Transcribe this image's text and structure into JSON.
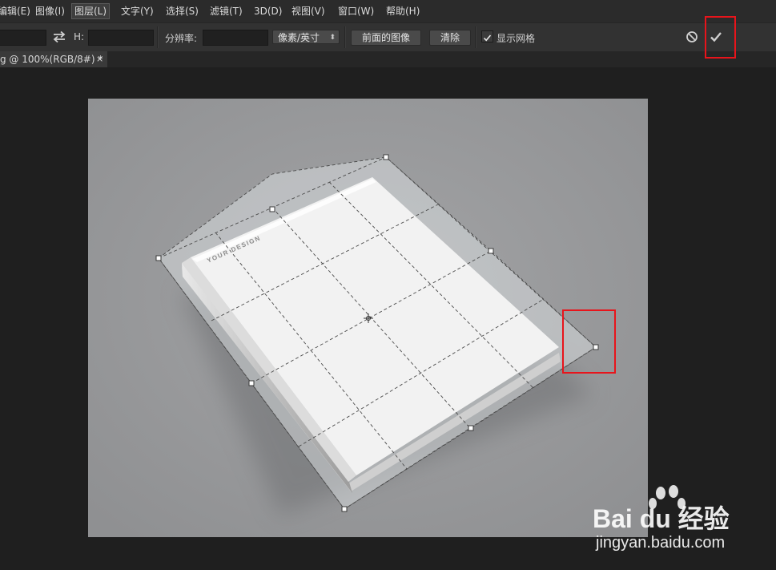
{
  "menubar": {
    "items": [
      "编辑(E)",
      "图像(I)",
      "图层(L)",
      "文字(Y)",
      "选择(S)",
      "滤镜(T)",
      "3D(D)",
      "视图(V)",
      "窗口(W)",
      "帮助(H)"
    ]
  },
  "options": {
    "height_label": "H:",
    "resolution_label": "分辨率:",
    "unit_select": "像素/英寸",
    "front_image_button": "前面的图像",
    "clear_button": "清除",
    "show_grid_label": "显示网格",
    "show_grid_checked": true,
    "swap_icon": "swap-arrows-icon",
    "cancel_icon": "cancel-icon",
    "commit_icon": "checkmark-icon"
  },
  "tab": {
    "title": "g @ 100%(RGB/8#) *",
    "close": "×"
  },
  "artwork": {
    "cover_text": "YOUR DESIGN"
  },
  "watermark": {
    "brand": "Bai du 经验",
    "url": "jingyan.baidu.com"
  },
  "colors": {
    "highlight": "#e8141b",
    "canvas_bg": "#98999b"
  }
}
